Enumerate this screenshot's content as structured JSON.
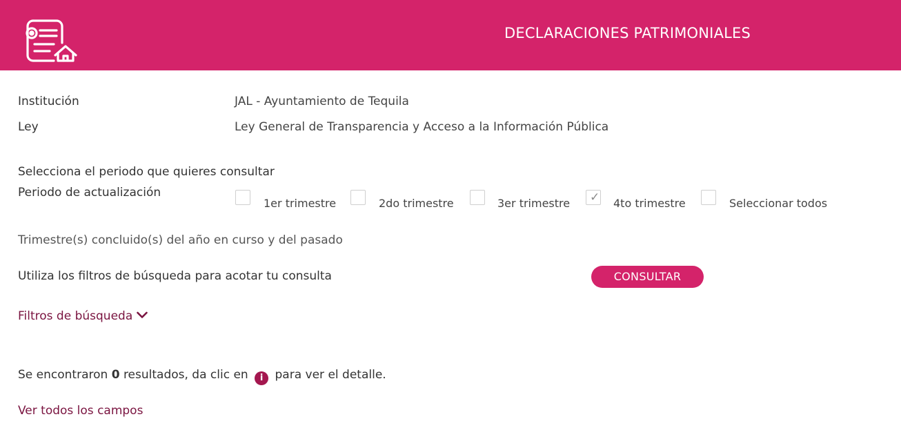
{
  "header": {
    "title": "DECLARACIONES PATRIMONIALES",
    "color": "#d4236a"
  },
  "info": {
    "institution_label": "Institución",
    "institution_value": "JAL - Ayuntamiento de Tequila",
    "law_label": "Ley",
    "law_value": "Ley General de Transparencia y Acceso a la Información Pública"
  },
  "period": {
    "prompt": "Selecciona el periodo que quieres consultar",
    "label": "Periodo de actualización",
    "options": [
      {
        "label": "1er trimestre",
        "checked": false
      },
      {
        "label": "2do trimestre",
        "checked": false
      },
      {
        "label": "3er trimestre",
        "checked": false
      },
      {
        "label": "4to trimestre",
        "checked": true
      },
      {
        "label": "Seleccionar todos",
        "checked": false
      }
    ],
    "note": "Trimestre(s) concluido(s) del año en curso y del pasado"
  },
  "search": {
    "hint": "Utiliza los filtros de búsqueda para acotar tu consulta",
    "button_label": "CONSULTAR",
    "filters_label": "Filtros de búsqueda"
  },
  "results": {
    "prefix": "Se encontraron",
    "count": "0",
    "middle": "resultados, da clic en",
    "suffix": "para ver el detalle.",
    "info_icon_glyph": "i",
    "view_all_label": "Ver todos los campos"
  },
  "icons": {
    "logo": "document-home-icon",
    "info": "info-icon",
    "chevron": "chevron-down-icon"
  }
}
